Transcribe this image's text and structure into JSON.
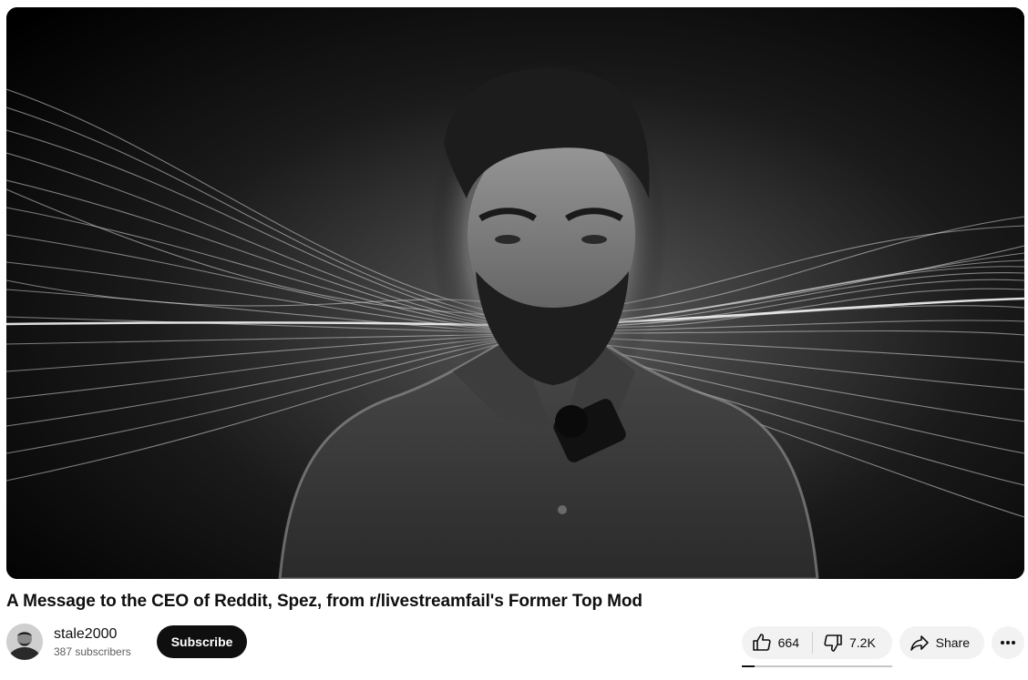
{
  "video": {
    "title": "A Message to the CEO of Reddit, Spez, from r/livestreamfail's Former Top Mod"
  },
  "channel": {
    "name": "stale2000",
    "subscribers": "387 subscribers"
  },
  "buttons": {
    "subscribe": "Subscribe",
    "like_count": "664",
    "dislike_count": "7.2K",
    "share": "Share"
  },
  "like_ratio": 0.084,
  "icons": {
    "like": "thumbs-up-icon",
    "dislike": "thumbs-down-icon",
    "share": "share-arrow-icon",
    "more": "more-horizontal-icon"
  },
  "colors": {
    "subscribe_bg": "#0f0f0f",
    "pill_bg": "#f2f2f2",
    "text_primary": "#0f0f0f",
    "text_secondary": "#606060"
  }
}
